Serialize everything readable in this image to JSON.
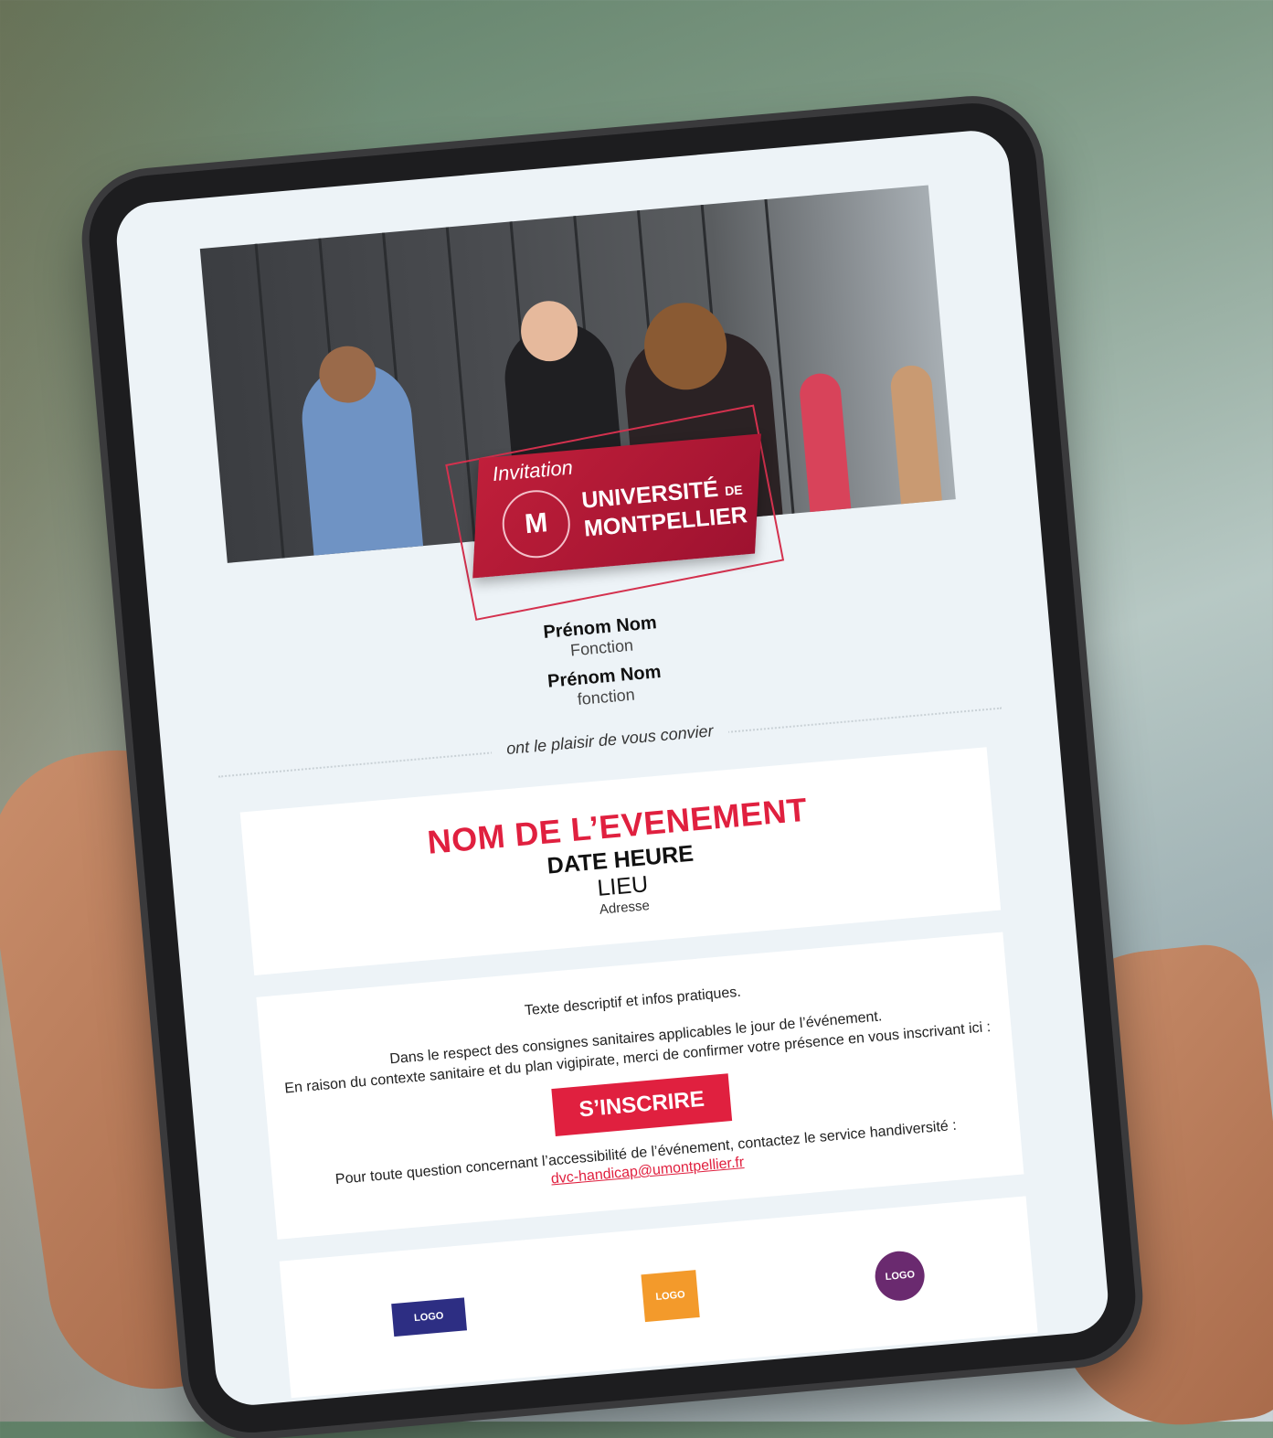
{
  "invitation": {
    "badge_label": "Invitation",
    "university_line1": "UNIVERSITÉ",
    "university_de": "DE",
    "university_line2": "MONTPELLIER",
    "seal_letter": "M"
  },
  "hosts": [
    {
      "name": "Prénom Nom",
      "function": "Fonction"
    },
    {
      "name": "Prénom Nom",
      "function": "fonction"
    }
  ],
  "invite_text": "ont le plaisir de vous convier",
  "event": {
    "title": "NOM DE L’EVENEMENT",
    "datetime": "DATE HEURE",
    "place": "LIEU",
    "address": "Adresse"
  },
  "info": {
    "description": "Texte descriptif et infos pratiques.",
    "health_line": "Dans le respect des consignes sanitaires applicables le jour de l’événement.",
    "context_line": "En raison du contexte sanitaire et du plan vigipirate, merci de confirmer votre présence en vous inscrivant ici :",
    "register_button": "S’INSCRIRE",
    "accessibility_line": "Pour toute question concernant l’accessibilité de l’événement, contactez le service handiversité :",
    "accessibility_email": "dvc-handicap@umontpellier.fr"
  },
  "partner_logos": [
    {
      "label": "LOGO",
      "color": "#2d2e83"
    },
    {
      "label": "LOGO",
      "color": "#f39a2b"
    },
    {
      "label": "LOGO",
      "color": "#6a2a6f"
    }
  ],
  "colors": {
    "accent": "#e0203f",
    "badge": "#c01f3a"
  }
}
